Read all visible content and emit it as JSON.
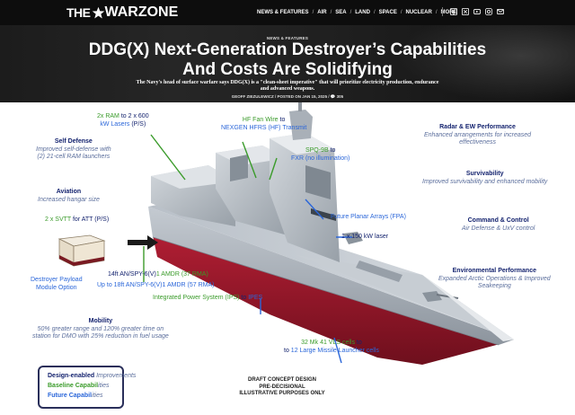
{
  "site": {
    "logo_prefix": "THE",
    "logo_name": "WARZONE"
  },
  "nav": {
    "items": [
      "NEWS & FEATURES",
      "AIR",
      "SEA",
      "LAND",
      "SPACE",
      "NUCLEAR",
      "MORE"
    ],
    "social_icons": [
      "facebook-icon",
      "x-icon",
      "youtube-icon",
      "instagram-icon",
      "email-icon"
    ]
  },
  "article": {
    "kicker": "NEWS & FEATURES",
    "headline": "DDG(X) Next-Generation Destroyer’s Capabilities And Costs Are Solidifying",
    "dek": "The Navy's head of surface warfare says DDG(X) is a \"clean-sheet imperative\" that will prioritize electricity production, endurance and advanced weapons.",
    "byline": "GEOFF ZIEZULEWICZ  /  POSTED ON JAN 15, 2025  /  💬 305"
  },
  "infographic": {
    "ram": {
      "part1": "2x RAM",
      "part2": " to 2 x 600",
      "part3": "kW Lasers",
      "part4": " (P/S)"
    },
    "hf": {
      "part1": "HF Fan Wire",
      "part2": " to",
      "line2": "NEXGEN HFRS (HF) Transmit"
    },
    "spq": {
      "part1": "SPQ-9B",
      "part2": " to",
      "line2": "FXR (no illumination)"
    },
    "self_defense": {
      "title": "Self Defense",
      "desc1": "Improved self-defense with",
      "desc2": "(2) 21-cell RAM launchers"
    },
    "aviation": {
      "title": "Aviation",
      "desc": "Increased hangar size"
    },
    "svtt": {
      "part1": "2 x SVTT",
      "part2": " for ATT",
      "part3": " (P/S)"
    },
    "payload": {
      "line1": "Destroyer Payload",
      "line2": "Module Option"
    },
    "radar_ew": {
      "title": "Radar & EW Performance",
      "desc1": "Enhanced arrangements for increased",
      "desc2": "effectiveness"
    },
    "survivability": {
      "title": "Survivability",
      "desc": "Improved survivability and enhanced mobility"
    },
    "c2": {
      "title": "Command & Control",
      "desc": "Air Defense & UxV control"
    },
    "env": {
      "title": "Environmental Performance",
      "desc1": "Expanded Arctic Operations & Improved",
      "desc2": "Seakeeping"
    },
    "fpa": "Future Planar Arrays (FPA)",
    "laser": "1 x 150 kW laser",
    "amdr1": {
      "part1": "14ft AN/SPY-6(V)",
      "part2": "1 AMDR (37 RMA)"
    },
    "amdr2": {
      "part1": "Up to 18ft AN/SPY-6(V)",
      "part2": "1 AMDR (57 RMA)"
    },
    "ips": {
      "part1": "Integrated Power System (IPS)",
      "part2": " to ",
      "part3": "IPES"
    },
    "mobility": {
      "title": "Mobility",
      "desc1": "50% greater range and 120% greater time on",
      "desc2": "station for DMO with 25% reduction in fuel usage"
    },
    "vls": {
      "part1": "32 Mk 41 VLS cells",
      "part2": " to",
      "line2_a": "to ",
      "line2_b": "12 Large Missile Launcher cells"
    },
    "legend": {
      "row1_a": "Design-enabled",
      "row1_b": " Improvements",
      "row2_a": "Baseline Capabil",
      "row2_b": "ities",
      "row3_a": "Future Capabil",
      "row3_b": "ities"
    },
    "disclaimer": [
      "DRAFT CONCEPT DESIGN",
      "PRE-DECISIONAL",
      "ILLUSTRATIVE PURPOSES ONLY"
    ]
  },
  "colors": {
    "nav_bg": "#0d0d0d",
    "headline_bg": "#141414",
    "label_navy": "#13226e",
    "label_blue": "#2a66d9",
    "label_green": "#3a9b2a",
    "desc_italic": "#5b6e9c",
    "hull_gray": "#a9b0b8",
    "hull_red": "#9b1a2c"
  }
}
